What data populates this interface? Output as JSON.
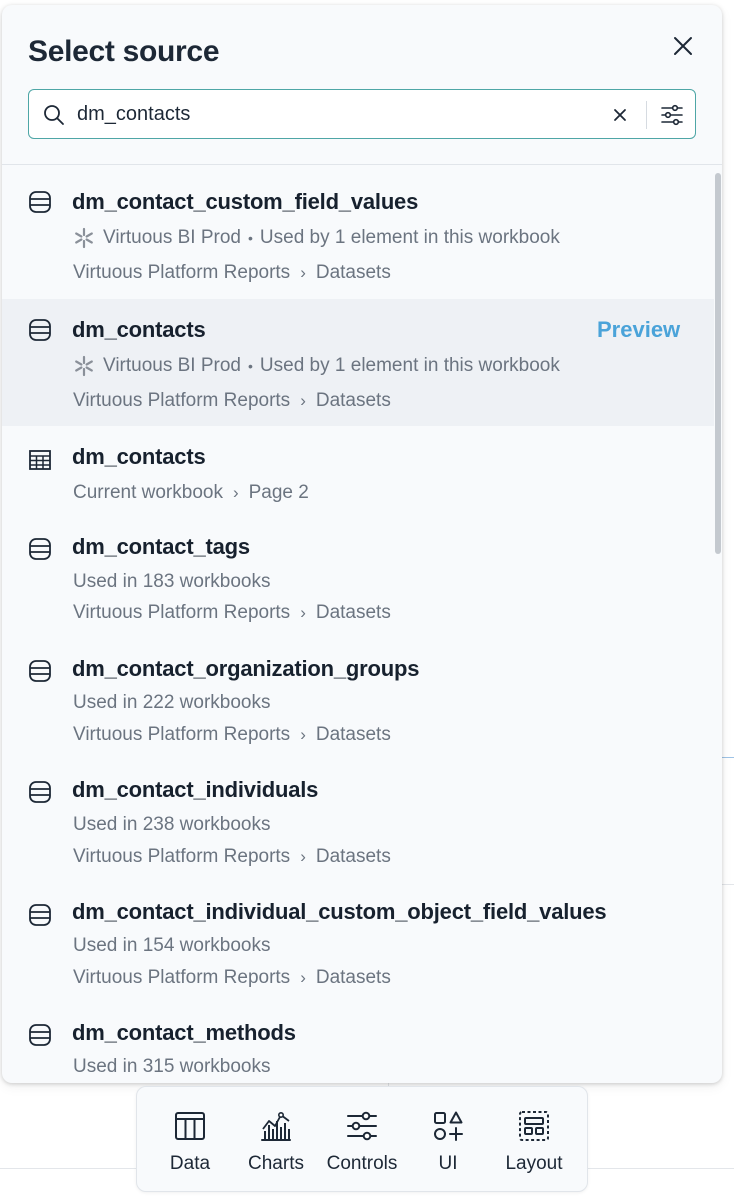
{
  "modal": {
    "title": "Select source",
    "search": {
      "value": "dm_contacts",
      "placeholder": "Search"
    }
  },
  "results": [
    {
      "name": "dm_contact_custom_field_values",
      "icon": "dataset-icon",
      "connection": "Virtuous BI Prod",
      "usage": "Used by 1 element in this workbook",
      "path": [
        "Virtuous Platform Reports",
        "Datasets"
      ]
    },
    {
      "name": "dm_contacts",
      "icon": "dataset-icon",
      "connection": "Virtuous BI Prod",
      "usage": "Used by 1 element in this workbook",
      "path": [
        "Virtuous Platform Reports",
        "Datasets"
      ],
      "action": "Preview"
    },
    {
      "name": "dm_contacts",
      "icon": "table-icon",
      "path": [
        "Current workbook",
        "Page 2"
      ]
    },
    {
      "name": "dm_contact_tags",
      "icon": "dataset-icon",
      "usage": "Used in 183 workbooks",
      "path": [
        "Virtuous Platform Reports",
        "Datasets"
      ]
    },
    {
      "name": "dm_contact_organization_groups",
      "icon": "dataset-icon",
      "usage": "Used in 222 workbooks",
      "path": [
        "Virtuous Platform Reports",
        "Datasets"
      ]
    },
    {
      "name": "dm_contact_individuals",
      "icon": "dataset-icon",
      "usage": "Used in 238 workbooks",
      "path": [
        "Virtuous Platform Reports",
        "Datasets"
      ]
    },
    {
      "name": "dm_contact_individual_custom_object_field_values",
      "icon": "dataset-icon",
      "usage": "Used in 154 workbooks",
      "path": [
        "Virtuous Platform Reports",
        "Datasets"
      ]
    },
    {
      "name": "dm_contact_methods",
      "icon": "dataset-icon",
      "usage": "Used in 315 workbooks"
    }
  ],
  "toolbar": {
    "items": [
      {
        "label": "Data",
        "icon": "table-icon"
      },
      {
        "label": "Charts",
        "icon": "chart-icon"
      },
      {
        "label": "Controls",
        "icon": "sliders-icon"
      },
      {
        "label": "UI",
        "icon": "shapes-icon"
      },
      {
        "label": "Layout",
        "icon": "layout-icon"
      }
    ]
  },
  "colors": {
    "accent": "#4aa3d9",
    "search_border": "#4ea6a6",
    "hover_row": "#eef1f5",
    "text": "#17212e",
    "muted": "#6b7480"
  }
}
